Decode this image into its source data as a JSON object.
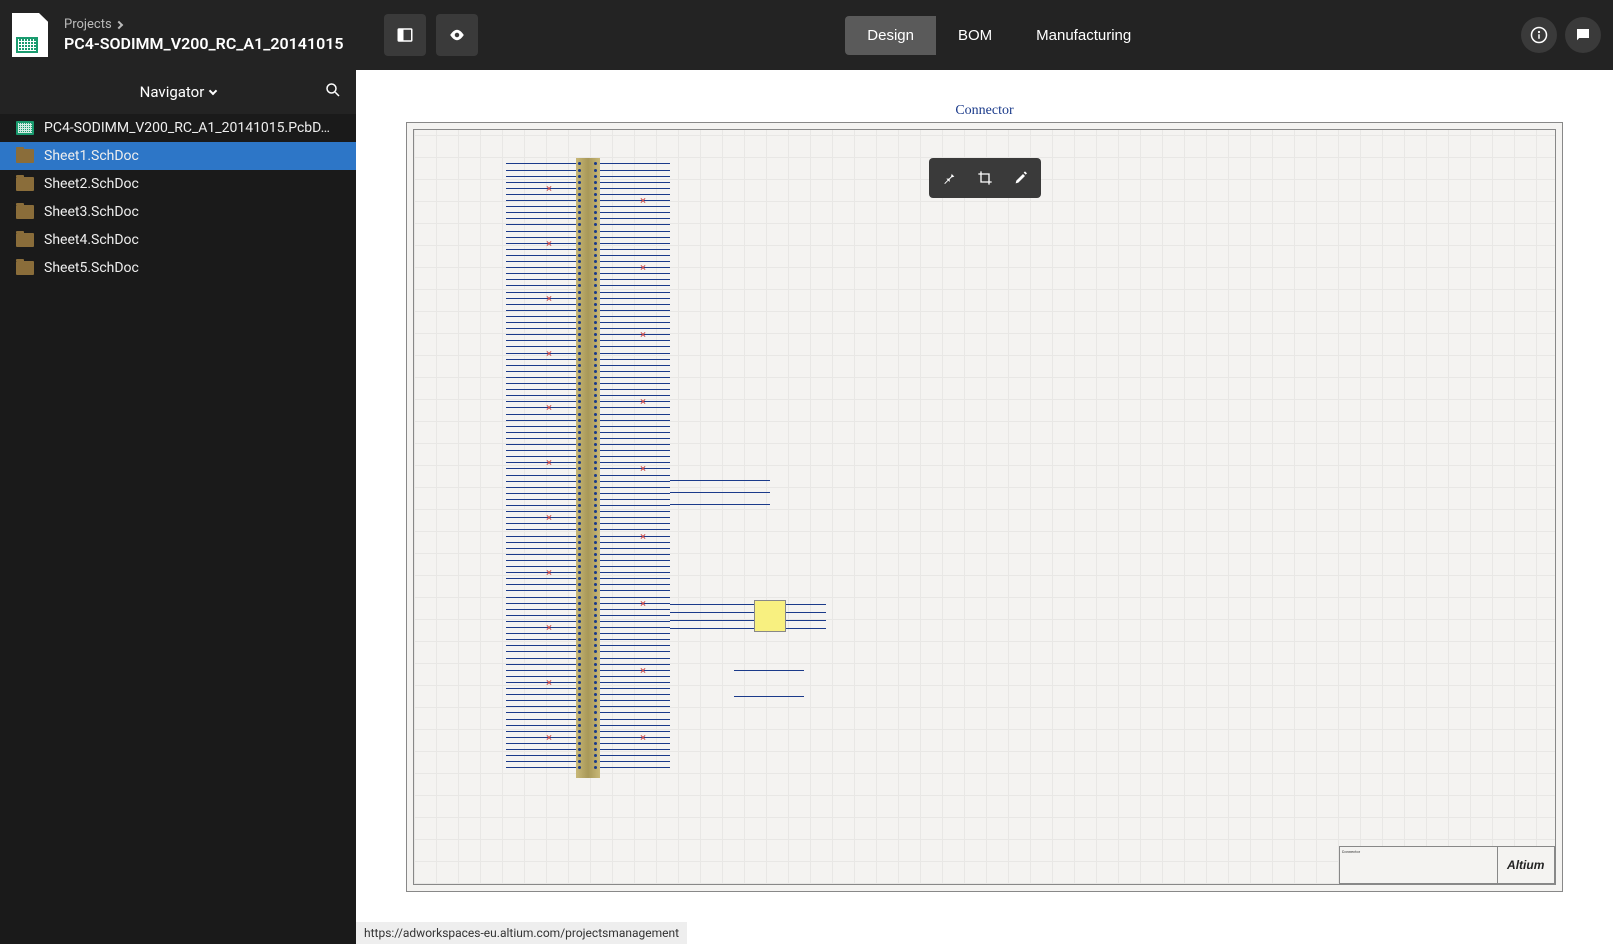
{
  "header": {
    "breadcrumb_root": "Projects",
    "project_title": "PC4-SODIMM_V200_RC_A1_20141015",
    "tabs": [
      {
        "label": "Design",
        "active": true
      },
      {
        "label": "BOM",
        "active": false
      },
      {
        "label": "Manufacturing",
        "active": false
      }
    ]
  },
  "sidebar": {
    "nav_label": "Navigator",
    "files": [
      {
        "name": "PC4-SODIMM_V200_RC_A1_20141015.PcbD…",
        "type": "pcb",
        "selected": false
      },
      {
        "name": "Sheet1.SchDoc",
        "type": "sch",
        "selected": true
      },
      {
        "name": "Sheet2.SchDoc",
        "type": "sch",
        "selected": false
      },
      {
        "name": "Sheet3.SchDoc",
        "type": "sch",
        "selected": false
      },
      {
        "name": "Sheet4.SchDoc",
        "type": "sch",
        "selected": false
      },
      {
        "name": "Sheet5.SchDoc",
        "type": "sch",
        "selected": false
      }
    ]
  },
  "schematic": {
    "sheet_label": "Connector",
    "title_block": {
      "title": "Connector",
      "brand": "Altium"
    }
  },
  "status_bar": {
    "url": "https://adworkspaces-eu.altium.com/projectsmanagement"
  }
}
